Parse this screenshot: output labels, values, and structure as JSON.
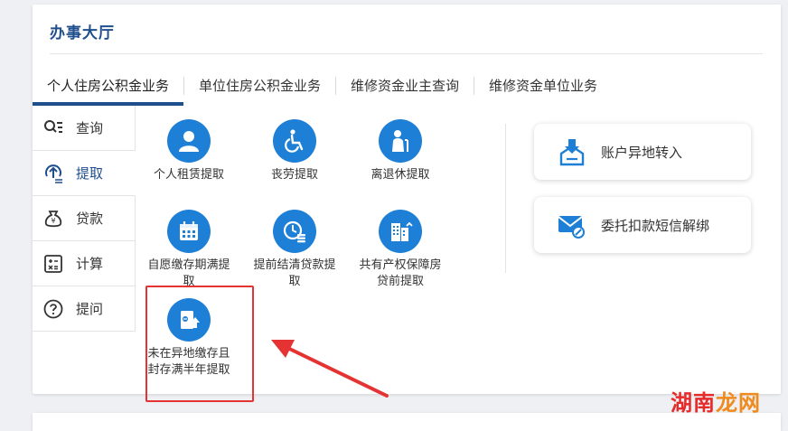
{
  "hall": {
    "title": "办事大厅"
  },
  "tabs": [
    {
      "label": "个人住房公积金业务",
      "active": true
    },
    {
      "label": "单位住房公积金业务",
      "active": false
    },
    {
      "label": "维修资金业主查询",
      "active": false
    },
    {
      "label": "维修资金单位业务",
      "active": false
    }
  ],
  "sidebar": {
    "items": [
      {
        "label": "查询",
        "icon": "search-list-icon",
        "active": false
      },
      {
        "label": "提取",
        "icon": "withdraw-icon",
        "active": true
      },
      {
        "label": "贷款",
        "icon": "money-bag-icon",
        "active": false
      },
      {
        "label": "计算",
        "icon": "calculator-icon",
        "active": false
      },
      {
        "label": "提问",
        "icon": "question-icon",
        "active": false
      }
    ]
  },
  "services": [
    {
      "label": "个人租赁提取",
      "icon": "person-icon"
    },
    {
      "label": "丧劳提取",
      "icon": "wheelchair-icon"
    },
    {
      "label": "离退休提取",
      "icon": "elderly-icon"
    },
    {
      "label": "自愿缴存期满提取",
      "icon": "calendar-icon"
    },
    {
      "label": "提前结清贷款提取",
      "icon": "clock-coins-icon"
    },
    {
      "label": "共有产权保障房贷前提取",
      "icon": "buildings-icon"
    },
    {
      "label": "未在异地缴存且封存满半年提取",
      "icon": "document-upload-icon"
    }
  ],
  "right_cards": [
    {
      "label": "账户异地转入",
      "icon": "transfer-in-icon"
    },
    {
      "label": "委托扣款短信解绑",
      "icon": "envelope-unlink-icon"
    }
  ],
  "watermark": {
    "part1": "湖南",
    "part2": "龙网"
  },
  "colors": {
    "accent": "#1f4e8c",
    "icon_blue": "#1e7fd6",
    "highlight": "#e53232"
  }
}
